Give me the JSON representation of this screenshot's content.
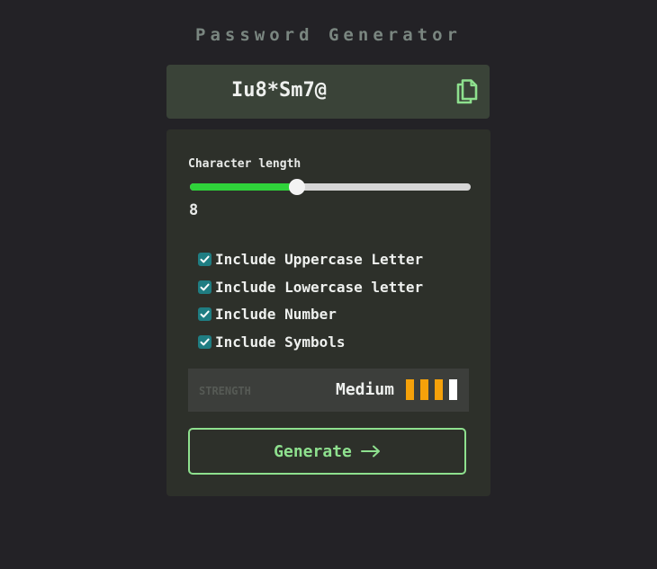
{
  "app": {
    "title": "Password Generator"
  },
  "output": {
    "password": "Iu8*Sm7@",
    "copy_icon": "copy-icon"
  },
  "settings": {
    "length_label": "Character length",
    "length_value": "8",
    "slider_fill_fraction": 0.38,
    "options": [
      {
        "label": "Include Uppercase Letter",
        "checked": true
      },
      {
        "label": "Include Lowercase letter",
        "checked": true
      },
      {
        "label": "Include Number",
        "checked": true
      },
      {
        "label": "Include Symbols",
        "checked": true
      }
    ]
  },
  "strength": {
    "label": "STRENGTH",
    "value": "Medium",
    "bars_filled": 3,
    "bars_total": 4
  },
  "generate": {
    "label": "Generate",
    "icon": "arrow-right-icon"
  },
  "colors": {
    "accent": "#8ee08e",
    "slider_fill": "#2fd33a",
    "strength_bar": "#f5a10a",
    "checkbox": "#1f7d82"
  }
}
